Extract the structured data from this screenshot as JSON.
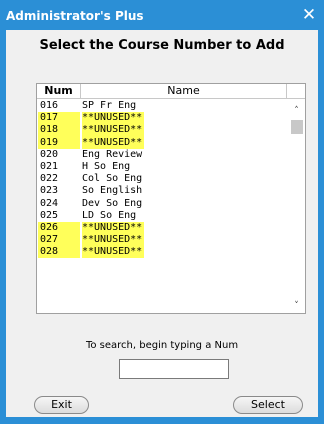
{
  "window": {
    "title": "Administrator's Plus",
    "close_glyph": "✕"
  },
  "heading": "Select the Course Number to Add",
  "list": {
    "columns": [
      "Num",
      "Name"
    ],
    "rows": [
      {
        "num": "016",
        "name": "SP Fr Eng",
        "highlighted": false
      },
      {
        "num": "017",
        "name": "**UNUSED**",
        "highlighted": true
      },
      {
        "num": "018",
        "name": "**UNUSED**",
        "highlighted": true
      },
      {
        "num": "019",
        "name": "**UNUSED**",
        "highlighted": true
      },
      {
        "num": "020",
        "name": "Eng Review",
        "highlighted": false
      },
      {
        "num": "021",
        "name": "H So Eng",
        "highlighted": false
      },
      {
        "num": "022",
        "name": "Col So Eng",
        "highlighted": false
      },
      {
        "num": "023",
        "name": "So English",
        "highlighted": false
      },
      {
        "num": "024",
        "name": "Dev So Eng",
        "highlighted": false
      },
      {
        "num": "025",
        "name": "LD So Eng",
        "highlighted": false
      },
      {
        "num": "026",
        "name": "**UNUSED**",
        "highlighted": true
      },
      {
        "num": "027",
        "name": "**UNUSED**",
        "highlighted": true
      },
      {
        "num": "028",
        "name": "**UNUSED**",
        "highlighted": true
      }
    ],
    "highlight_color": "#ffff5a",
    "scroll_up_icon": "˄",
    "scroll_down_icon": "˅"
  },
  "search": {
    "label": "To search, begin typing a Num",
    "value": ""
  },
  "buttons": {
    "exit_label": "Exit",
    "select_label": "Select"
  },
  "colors": {
    "titlebar": "#2b8fd6",
    "client": "#f0f0f0"
  }
}
